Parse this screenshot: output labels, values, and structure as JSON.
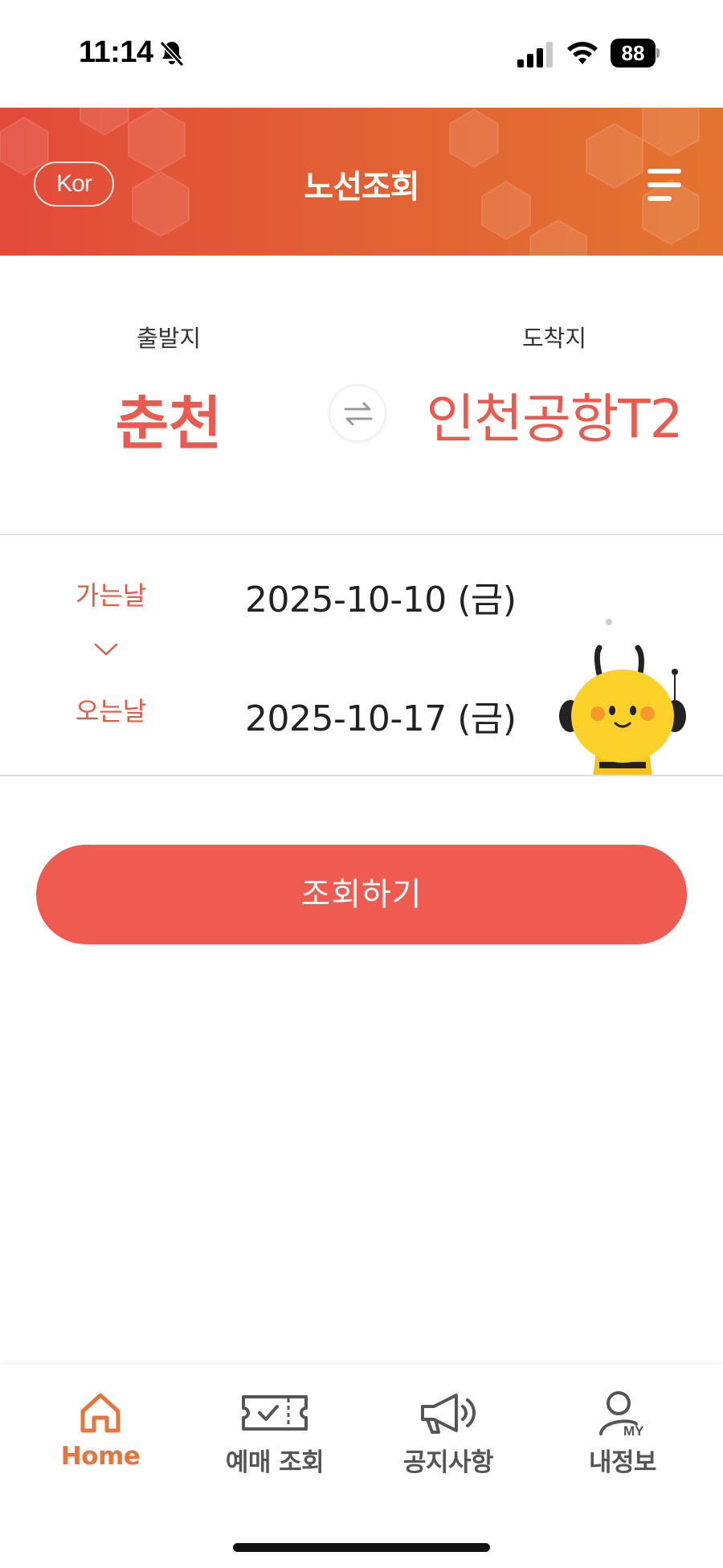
{
  "status_bar": {
    "time": "11:14",
    "battery": "88",
    "icons": [
      "bell-off-icon",
      "signal-icon",
      "wifi-icon",
      "battery-icon"
    ]
  },
  "header": {
    "language": "Kor",
    "title": "노선조회",
    "menu_icon": "menu-icon",
    "colors": {
      "gradient_start": "#e24a3a",
      "gradient_end": "#e3742f"
    }
  },
  "route": {
    "departure_label": "출발지",
    "departure_city": "춘천",
    "arrival_label": "도착지",
    "arrival_city": "인천공항T2",
    "swap_icon": "swap-arrows-icon",
    "accent_color": "#ea5a4f"
  },
  "dates": {
    "depart_label": "가는날",
    "depart_value": "2025-10-10 (금)",
    "return_label": "오는날",
    "return_value": "2025-10-17 (금)",
    "mascot": "bee-mascot"
  },
  "search_button": {
    "label": "조회하기",
    "color": "#ef5b50"
  },
  "bottom_nav": {
    "items": [
      {
        "label": "Home",
        "icon": "home-icon",
        "active": true
      },
      {
        "label": "예매 조회",
        "icon": "ticket-icon",
        "active": false
      },
      {
        "label": "공지사항",
        "icon": "megaphone-icon",
        "active": false
      },
      {
        "label": "내정보",
        "icon": "profile-icon",
        "active": false
      }
    ],
    "profile_badge": "MY",
    "active_color": "#e7743a"
  }
}
